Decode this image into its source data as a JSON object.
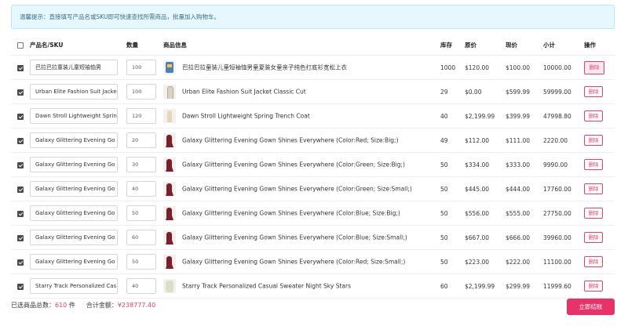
{
  "notice": "温馨提示：直接填写产品名或SKU即可快速查找所需商品，批量加入购物车。",
  "columns": {
    "name": "产品名/SKU",
    "qty": "数量",
    "info": "商品信息",
    "stock": "库存",
    "orig": "原价",
    "price": "现价",
    "subtotal": "小计",
    "action": "操作"
  },
  "rows": [
    {
      "sku": "巴拉巴拉童装儿童短袖恤男",
      "qty": "100",
      "thumb": "kids",
      "name": "巴拉巴拉童装儿童短袖恤男童夏装女童亲子纯色打底衫宽松上衣",
      "stock": "1000",
      "orig": "$120.00",
      "price": "$100.00",
      "subtotal": "10000.00",
      "del": "删除"
    },
    {
      "sku": "Urban Elite Fashion Suit Jacke",
      "qty": "100",
      "thumb": "suit",
      "name": "Urban Elite Fashion Suit Jacket Classic Cut",
      "stock": "29",
      "orig": "$0.00",
      "price": "$599.99",
      "subtotal": "59999.00",
      "del": "删除"
    },
    {
      "sku": "Dawn Stroll Lightweight Sprin",
      "qty": "120",
      "thumb": "coat",
      "name": "Dawn Stroll Lightweight Spring Trench Coat",
      "stock": "40",
      "orig": "$2,199.99",
      "price": "$399.99",
      "subtotal": "47998.80",
      "del": "删除"
    },
    {
      "sku": "Galaxy Glittering Evening Go",
      "qty": "20",
      "thumb": "gown",
      "name": "Galaxy Glittering Evening Gown Shines Everywhere (Color:Red; Size:Big;)",
      "stock": "49",
      "orig": "$112.00",
      "price": "$111.00",
      "subtotal": "2220.00",
      "del": "删除"
    },
    {
      "sku": "Galaxy Glittering Evening Go",
      "qty": "30",
      "thumb": "gown",
      "name": "Galaxy Glittering Evening Gown Shines Everywhere (Color:Green; Size:Big;)",
      "stock": "50",
      "orig": "$334.00",
      "price": "$333.00",
      "subtotal": "9990.00",
      "del": "删除"
    },
    {
      "sku": "Galaxy Glittering Evening Go",
      "qty": "40",
      "thumb": "gown",
      "name": "Galaxy Glittering Evening Gown Shines Everywhere (Color:Green; Size:Small;)",
      "stock": "50",
      "orig": "$445.00",
      "price": "$444.00",
      "subtotal": "17760.00",
      "del": "删除"
    },
    {
      "sku": "Galaxy Glittering Evening Go",
      "qty": "50",
      "thumb": "gown",
      "name": "Galaxy Glittering Evening Gown Shines Everywhere (Color:Blue; Size:Big;)",
      "stock": "50",
      "orig": "$556.00",
      "price": "$555.00",
      "subtotal": "27750.00",
      "del": "删除"
    },
    {
      "sku": "Galaxy Glittering Evening Go",
      "qty": "60",
      "thumb": "gown",
      "name": "Galaxy Glittering Evening Gown Shines Everywhere (Color:Blue; Size:Small;)",
      "stock": "50",
      "orig": "$667.00",
      "price": "$666.00",
      "subtotal": "39960.00",
      "del": "删除"
    },
    {
      "sku": "Galaxy Glittering Evening Go",
      "qty": "50",
      "thumb": "gown",
      "name": "Galaxy Glittering Evening Gown Shines Everywhere (Color:Red; Size:Small;)",
      "stock": "50",
      "orig": "$223.00",
      "price": "$222.00",
      "subtotal": "11100.00",
      "del": "删除"
    },
    {
      "sku": "Starry Track Personalized Cas",
      "qty": "40",
      "thumb": "sweater",
      "name": "Starry Track Personalized Casual Sweater Night Sky Stars",
      "stock": "60",
      "orig": "$2,199.99",
      "price": "$299.99",
      "subtotal": "11999.60",
      "del": "删除"
    }
  ],
  "footer": {
    "count_label": "已选商品总数：",
    "count": "610",
    "count_unit": "件",
    "total_label": "合计金额：",
    "total": "¥238777.40"
  },
  "checkout_label": "立即结账"
}
